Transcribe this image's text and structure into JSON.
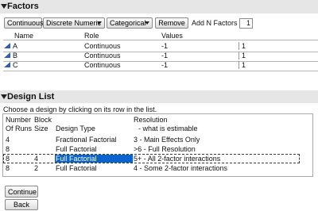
{
  "factors": {
    "title": "Factors",
    "buttons": {
      "continuous": "Continuous",
      "discrete_numeric": "Discrete Numeric",
      "categorical": "Categorical",
      "remove": "Remove"
    },
    "add_n_label": "Add N Factors",
    "add_n_value": "1",
    "headers": {
      "name": "Name",
      "role": "Role",
      "values": "Values"
    },
    "rows": [
      {
        "name": "A",
        "role": "Continuous",
        "low": "-1",
        "high": "1"
      },
      {
        "name": "B",
        "role": "Continuous",
        "low": "-1",
        "high": "1"
      },
      {
        "name": "C",
        "role": "Continuous",
        "low": "-1",
        "high": "1"
      }
    ]
  },
  "design_list": {
    "title": "Design List",
    "instruction": "Choose a design by clicking on its row in the list.",
    "headers": {
      "runs_1": "Number",
      "runs_2": "Of Runs",
      "block_1": "Block",
      "block_2": "Size",
      "type": "Design Type",
      "res_1": "Resolution",
      "res_2": "- what is estimable"
    },
    "rows": [
      {
        "runs": "4",
        "block": "",
        "type": "Fractional Factorial",
        "resolution": "3 - Main Effects Only"
      },
      {
        "runs": "8",
        "block": "",
        "type": "Full Factorial",
        "resolution": ">6 - Full Resolution"
      },
      {
        "runs": "8",
        "block": "4",
        "type": "Full Factorial",
        "resolution": "5+ - All 2-factor interactions",
        "selected": true
      },
      {
        "runs": "8",
        "block": "2",
        "type": "Full Factorial",
        "resolution": "4 - Some 2-factor interactions"
      }
    ]
  },
  "footer": {
    "continue_label": "Continue",
    "back_label": "Back"
  },
  "colors": {
    "selection": "#0a64d0",
    "factor_icon": "#2f5fb0"
  }
}
